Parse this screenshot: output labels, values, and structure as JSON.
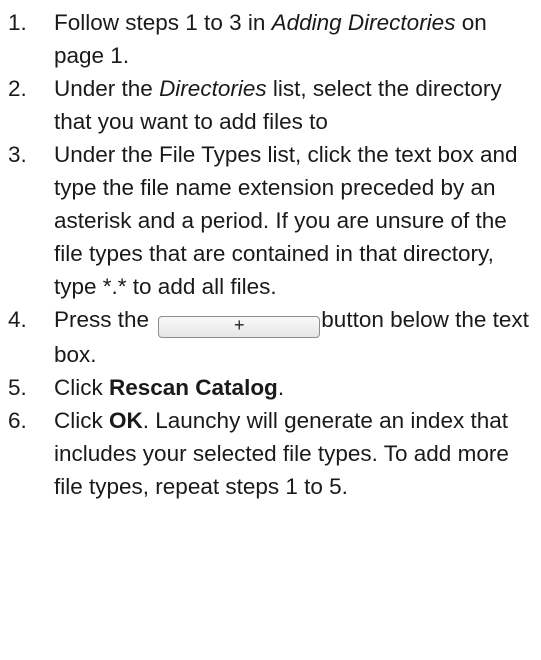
{
  "steps": [
    {
      "number": "1.",
      "before": "Follow steps  1 to 3 in ",
      "ref": "Adding Directories",
      "after": " on page 1."
    },
    {
      "number": "2.",
      "before": "Under the ",
      "ref": "Directories",
      "after": " list, select the directory that you want to add files to"
    },
    {
      "number": "3.",
      "text": "Under the File Types list, click the text box and type the file name extension preceded by an asterisk and a period. If you are unsure of the file types that are contained in that directory, type *.* to add all files."
    },
    {
      "number": "4.",
      "before": "Press the ",
      "button_label": "+",
      "after": "button below the text box."
    },
    {
      "number": "5.",
      "before": "Click ",
      "bold": "Rescan Catalog",
      "after": "."
    },
    {
      "number": "6.",
      "before": "Click ",
      "bold": "OK",
      "after": ". Launchy will generate an index that includes your selected file types. To add more file types, repeat steps 1 to 5."
    }
  ]
}
